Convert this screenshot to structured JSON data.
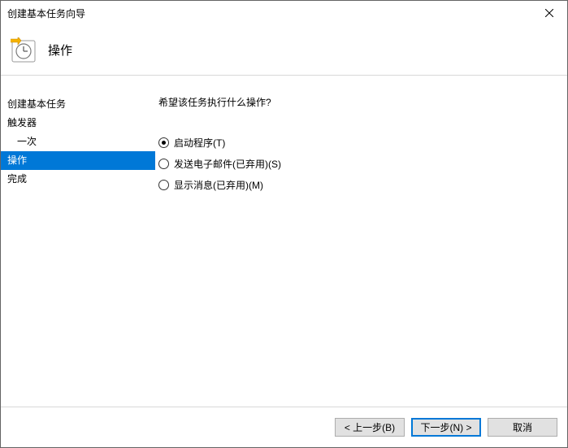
{
  "window": {
    "title": "创建基本任务向导"
  },
  "header": {
    "title": "操作"
  },
  "sidebar": {
    "items": [
      {
        "label": "创建基本任务",
        "indent": false,
        "selected": false
      },
      {
        "label": "触发器",
        "indent": false,
        "selected": false
      },
      {
        "label": "一次",
        "indent": true,
        "selected": false
      },
      {
        "label": "操作",
        "indent": false,
        "selected": true
      },
      {
        "label": "完成",
        "indent": false,
        "selected": false
      }
    ]
  },
  "content": {
    "question": "希望该任务执行什么操作?",
    "radios": [
      {
        "label": "启动程序(T)",
        "checked": true
      },
      {
        "label": "发送电子邮件(已弃用)(S)",
        "checked": false
      },
      {
        "label": "显示消息(已弃用)(M)",
        "checked": false
      }
    ]
  },
  "footer": {
    "back": "< 上一步(B)",
    "next": "下一步(N) >",
    "cancel": "取消"
  }
}
